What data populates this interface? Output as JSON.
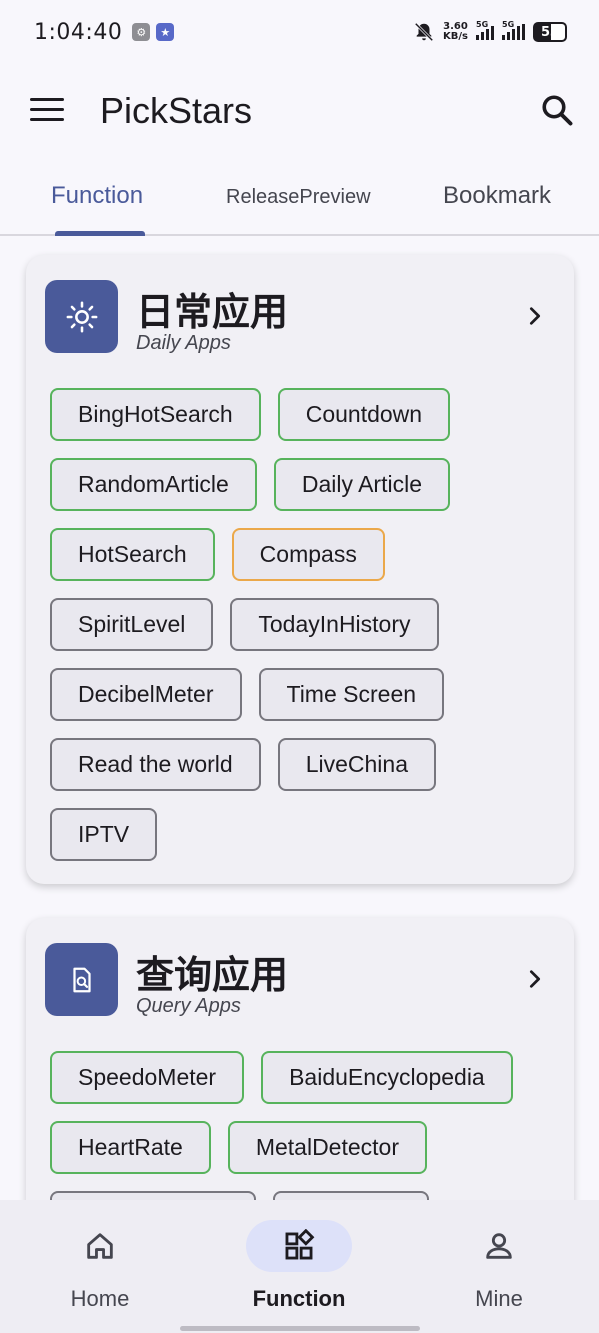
{
  "status_bar": {
    "time": "1:04:40",
    "speed_value": "3.60",
    "speed_unit": "KB/s",
    "network_1": "5G",
    "network_2": "5G",
    "battery": "53"
  },
  "app_bar": {
    "title": "PickStars",
    "menu_icon": "hamburger-menu-icon",
    "search_icon": "search-icon"
  },
  "tabs": [
    {
      "label": "Function",
      "active": true
    },
    {
      "label": "ReleasePreview",
      "active": false
    },
    {
      "label": "Bookmark",
      "active": false
    }
  ],
  "cards": [
    {
      "title": "日常应用",
      "subtitle": "Daily Apps",
      "icon": "sun-icon",
      "chips": [
        {
          "label": "BingHotSearch",
          "status": "green"
        },
        {
          "label": "Countdown",
          "status": "green"
        },
        {
          "label": "RandomArticle",
          "status": "green"
        },
        {
          "label": "Daily Article",
          "status": "green"
        },
        {
          "label": "HotSearch",
          "status": "green"
        },
        {
          "label": "Compass",
          "status": "orange"
        },
        {
          "label": "SpiritLevel",
          "status": "gray"
        },
        {
          "label": "TodayInHistory",
          "status": "gray"
        },
        {
          "label": "DecibelMeter",
          "status": "gray"
        },
        {
          "label": "Time Screen",
          "status": "gray"
        },
        {
          "label": "Read the world",
          "status": "gray"
        },
        {
          "label": "LiveChina",
          "status": "gray"
        },
        {
          "label": "IPTV",
          "status": "gray"
        }
      ]
    },
    {
      "title": "查询应用",
      "subtitle": "Query Apps",
      "icon": "document-search-icon",
      "chips": [
        {
          "label": "SpeedoMeter",
          "status": "green"
        },
        {
          "label": "BaiduEncyclopedia",
          "status": "green"
        },
        {
          "label": "HeartRate",
          "status": "green"
        },
        {
          "label": "MetalDetector",
          "status": "green"
        }
      ]
    }
  ],
  "bottom_nav": [
    {
      "label": "Home",
      "icon": "home-icon",
      "active": false
    },
    {
      "label": "Function",
      "icon": "grid-icon",
      "active": true
    },
    {
      "label": "Mine",
      "icon": "person-icon",
      "active": false
    }
  ],
  "colors": {
    "accent": "#4a5a9a",
    "chip_green": "#57b35c",
    "chip_orange": "#eba84a",
    "chip_gray": "#77767e"
  }
}
